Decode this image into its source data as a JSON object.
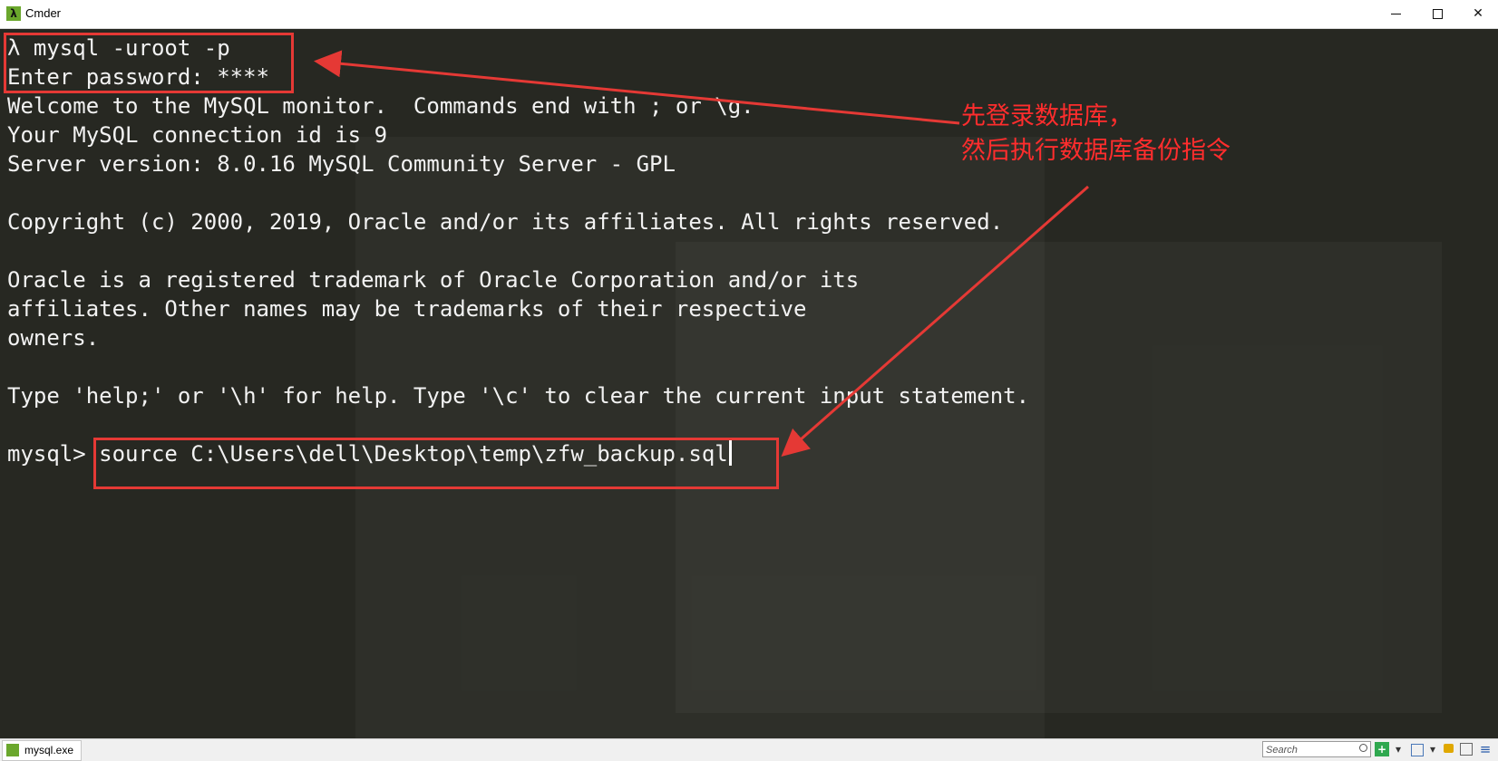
{
  "window": {
    "title": "Cmder",
    "app_icon_glyph": "λ",
    "controls": {
      "minimize": "minimize-icon",
      "maximize": "maximize-icon",
      "close_glyph": "✕"
    }
  },
  "terminal": {
    "lines": [
      "λ mysql -uroot -p",
      "Enter password: ****",
      "Welcome to the MySQL monitor.  Commands end with ; or \\g.",
      "Your MySQL connection id is 9",
      "Server version: 8.0.16 MySQL Community Server - GPL",
      "",
      "Copyright (c) 2000, 2019, Oracle and/or its affiliates. All rights reserved.",
      "",
      "Oracle is a registered trademark of Oracle Corporation and/or its",
      "affiliates. Other names may be trademarks of their respective",
      "owners.",
      "",
      "Type 'help;' or '\\h' for help. Type '\\c' to clear the current input statement.",
      ""
    ],
    "prompt": "mysql> ",
    "command": "source C:\\Users\\dell\\Desktop\\temp\\zfw_backup.sql"
  },
  "annotation": {
    "line1": "先登录数据库，",
    "line2": "然后执行数据库备份指令",
    "color": "#ff2d2d"
  },
  "statusbar": {
    "tab_label": "mysql.exe",
    "search_placeholder": "Search",
    "icons": [
      "new-console-icon",
      "dropdown-arrow-icon",
      "view-icon",
      "lock-icon",
      "split-icon",
      "menu-icon"
    ],
    "add_glyph": "+",
    "dropdown_glyph": "▾",
    "menu_glyph": "≡",
    "lock_glyph": "🔒"
  },
  "colors": {
    "terminal_bg": "#272822",
    "terminal_fg": "#f2f2f2",
    "annotation": "#e53935"
  }
}
